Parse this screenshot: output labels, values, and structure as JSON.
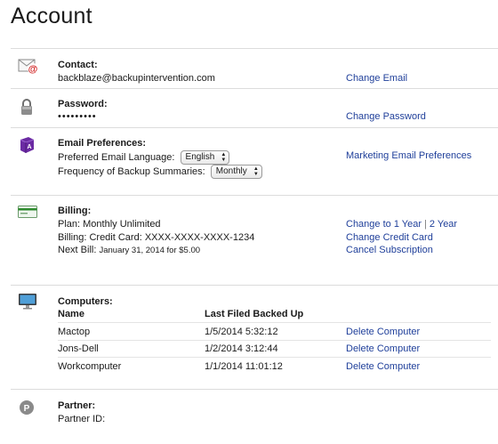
{
  "page": {
    "title": "Account"
  },
  "contact": {
    "heading": "Contact:",
    "email": "backblaze@backupintervention.com",
    "change_email_link": "Change Email",
    "icon": "mail-at-icon"
  },
  "password": {
    "heading": "Password:",
    "masked_value": "•••••••••",
    "change_password_link": "Change Password",
    "icon": "padlock-icon"
  },
  "email_preferences": {
    "heading": "Email Preferences:",
    "language_label": "Preferred Email Language:",
    "language_value": "English",
    "frequency_label": "Frequency of Backup Summaries:",
    "frequency_value": "Monthly",
    "marketing_link": "Marketing Email Preferences",
    "icon": "dictionary-icon"
  },
  "billing": {
    "heading": "Billing:",
    "plan_text": "Plan: Monthly Unlimited",
    "billing_text": "Billing: Credit Card: XXXX-XXXX-XXXX-1234",
    "next_bill_label": "Next Bill:",
    "next_bill_value": "January 31, 2014 for $5.00",
    "change_1year_link": "Change to 1 Year",
    "separator": "|",
    "change_2year_link": "2 Year",
    "change_card_link": "Change Credit Card",
    "cancel_link": "Cancel Subscription",
    "icon": "credit-card-icon"
  },
  "computers": {
    "heading": "Computers:",
    "col_name": "Name",
    "col_last_filed": "Last Filed Backed Up",
    "rows": [
      {
        "name": "Mactop",
        "last": "1/5/2014 5:32:12",
        "action": "Delete Computer"
      },
      {
        "name": "Jons-Dell",
        "last": "1/2/2014 3:12:44",
        "action": "Delete Computer"
      },
      {
        "name": "Workcomputer",
        "last": "1/1/2014 11:01:12",
        "action": "Delete Computer"
      }
    ],
    "icon": "monitor-icon"
  },
  "partner": {
    "heading": "Partner:",
    "id_label": "Partner ID:",
    "icon_letter": "P",
    "icon": "partner-p-icon"
  },
  "colors": {
    "link": "#1f3f9a",
    "divider": "#dcdcdc"
  }
}
